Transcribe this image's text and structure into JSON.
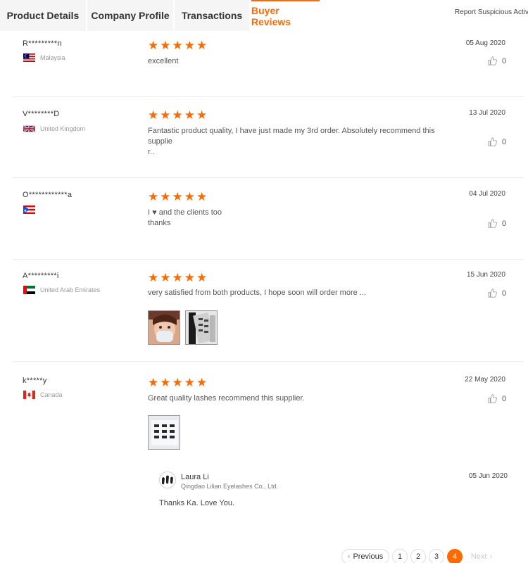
{
  "tabs": [
    {
      "label": "Product Details",
      "active": false
    },
    {
      "label": "Company Profile",
      "active": false
    },
    {
      "label": "Transactions",
      "active": false
    },
    {
      "label": "Buyer Reviews",
      "active": true
    }
  ],
  "report_link": "Report Suspicious Activity",
  "reviews": [
    {
      "name": "R*********n",
      "country": "Malaysia",
      "rating": 5,
      "date": "05 Aug 2020",
      "text_lines": [
        "excellent"
      ],
      "likes": "0"
    },
    {
      "name": "V********D",
      "country": "United Kingdom",
      "rating": 5,
      "date": "13 Jul 2020",
      "text_lines": [
        "Fantastic product quality, I have just made my 3rd order. Absolutely recommend this supplie",
        "r.."
      ],
      "likes": "0"
    },
    {
      "name": "O************a",
      "country": "",
      "rating": 5,
      "date": "04 Jul 2020",
      "text_lines": [
        "and the clients too",
        "thanks"
      ],
      "text_prefix": "I",
      "likes": "0"
    },
    {
      "name": "A*********i",
      "country": "United Arab Emirates",
      "rating": 5,
      "date": "15 Jun 2020",
      "text_lines": [
        "very satisfied from both products, I hope soon will order more ..."
      ],
      "likes": "0"
    },
    {
      "name": "k*****y",
      "country": "Canada",
      "rating": 5,
      "date": "22 May 2020",
      "text_lines": [
        "Great quality lashes recommend this supplier."
      ],
      "likes": "0"
    }
  ],
  "reply": {
    "name": "Laura Li",
    "company": "Qingdao Lilian Eyelashes Co., Ltd.",
    "date": "05 Jun 2020",
    "text": "Thanks Ka. Love You."
  },
  "pagination": {
    "prev": "Previous",
    "pages": [
      "1",
      "2",
      "3",
      "4"
    ],
    "active": "4",
    "next": "Next"
  },
  "colors": {
    "accent": "#ff6a00"
  }
}
